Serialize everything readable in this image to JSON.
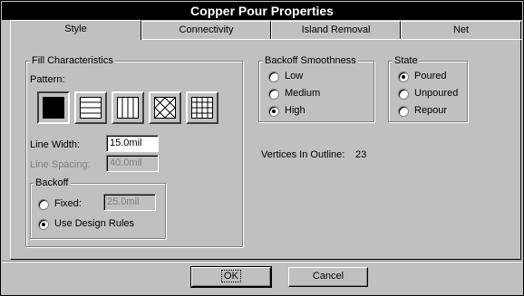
{
  "window": {
    "title": "Copper Pour Properties"
  },
  "tabs": [
    {
      "label": "Style",
      "active": true
    },
    {
      "label": "Connectivity",
      "active": false
    },
    {
      "label": "Island Removal",
      "active": false
    },
    {
      "label": "Net",
      "active": false
    }
  ],
  "fill": {
    "group_label": "Fill Characteristics",
    "pattern_label": "Pattern:",
    "patterns": [
      "solid-pattern-icon",
      "horizontal-hatch-pattern-icon",
      "vertical-hatch-pattern-icon",
      "diagonal-cross-hatch-pattern-icon",
      "grid-hatch-pattern-icon"
    ],
    "selected_pattern": "solid-pattern-icon",
    "line_width_label": "Line Width:",
    "line_width_value": "15.0mil",
    "line_spacing_label": "Line Spacing:",
    "line_spacing_value": "40.0mil"
  },
  "backoff": {
    "group_label": "Backoff",
    "fixed_label": "Fixed:",
    "fixed_value": "25.0mil",
    "design_rules_label": "Use Design Rules",
    "selected": "Use Design Rules"
  },
  "smoothness": {
    "group_label": "Backoff Smoothness",
    "options": [
      "Low",
      "Medium",
      "High"
    ],
    "selected": "High"
  },
  "state": {
    "group_label": "State",
    "options": [
      "Poured",
      "Unpoured",
      "Repour"
    ],
    "selected": "Poured"
  },
  "vertices": {
    "label": "Vertices In Outline:",
    "value": "23"
  },
  "buttons": {
    "ok": "OK",
    "cancel": "Cancel"
  },
  "colors": {
    "face": "#c0c0c0",
    "title_bg": "#000000",
    "disabled_text": "#808080"
  }
}
